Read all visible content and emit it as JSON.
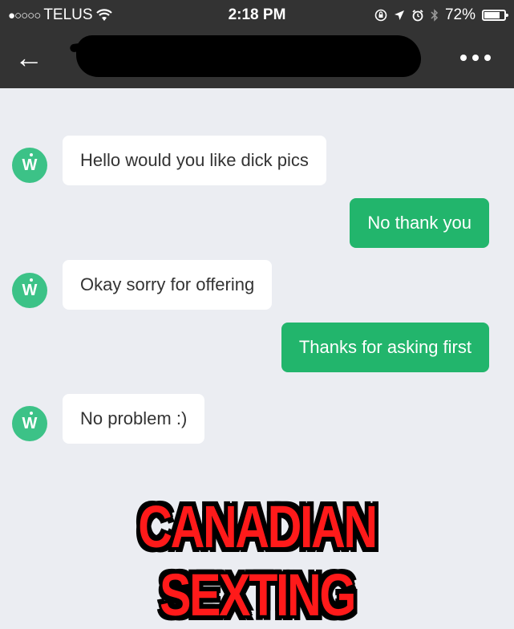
{
  "status_bar": {
    "signal": "●○○○○",
    "carrier": "TELUS",
    "wifi_icon": "wifi-icon",
    "time": "2:18 PM",
    "battery": "72%",
    "battery_level": 0.72
  },
  "navbar": {
    "back_icon": "←",
    "more_icon": "more-dots-icon"
  },
  "messages": [
    {
      "direction": "in",
      "avatar": "W",
      "text": "Hello would you like dick pics"
    },
    {
      "direction": "out",
      "text": "No thank you"
    },
    {
      "direction": "in",
      "avatar": "W",
      "text": "Okay sorry for offering"
    },
    {
      "direction": "out",
      "text": "Thanks for asking first"
    },
    {
      "direction": "in",
      "avatar": "W",
      "text": "No problem :)"
    }
  ],
  "caption": "CANADIAN SEXTING",
  "colors": {
    "header": "#333333",
    "outgoing_bubble": "#22b56c",
    "avatar": "#3cc287",
    "caption": "#ff1a1a"
  }
}
